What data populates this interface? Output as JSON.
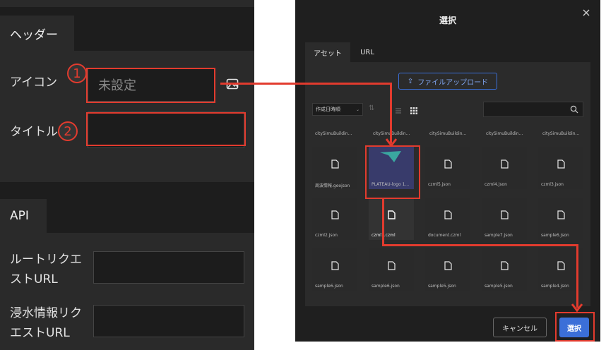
{
  "left_panel": {
    "header_section": {
      "tab_label": "ヘッダー",
      "icon_label": "アイコン",
      "icon_placeholder": "未設定",
      "title_label": "タイトル",
      "title_value": ""
    },
    "api_section": {
      "tab_label": "API",
      "route_label_line1": "ルートリクエ",
      "route_label_line2": "ストURL",
      "flood_label_line1": "浸水情報リク",
      "flood_label_line2": "エストURL"
    },
    "annotations": {
      "step1": "1",
      "step2": "2"
    }
  },
  "dialog": {
    "title": "選択",
    "tabs": [
      "アセット",
      "URL"
    ],
    "active_tab": "アセット",
    "upload_label": "ファイルアップロード",
    "sort_label": "作成日時順",
    "search_placeholder": "",
    "top_row_names": [
      "citySimuBuildin...",
      "citySimuBuildin...",
      "citySimuBuildin...",
      "citySimuBuildin...",
      "citySimuBuildin..."
    ],
    "rows": [
      [
        "周波情報.geojson",
        "PLATEAU-logo 1...",
        "czml5.json",
        "czml4.json",
        "czml3.json"
      ],
      [
        "czml2.json",
        "czml1.czml",
        "document.czml",
        "sample7.json",
        "sample6.json"
      ],
      [
        "sample6.json",
        "sample6.json",
        "sample5.json",
        "sample5.json",
        "sample4.json"
      ]
    ],
    "cancel_label": "キャンセル",
    "select_label": "選択"
  },
  "colors": {
    "accent": "#3b6fd8",
    "annotation": "#e23b2e",
    "panel_bg": "#2a2a2a",
    "dialog_bg": "#1f1f1f"
  }
}
